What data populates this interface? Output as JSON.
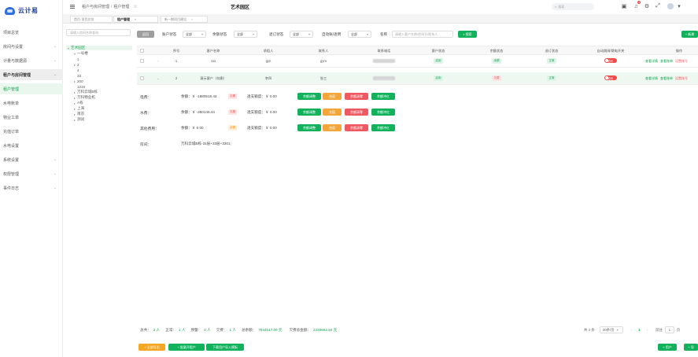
{
  "app": {
    "logo_text": "云计易"
  },
  "sidebar": {
    "items": [
      {
        "label": "项目总览",
        "chevron": false,
        "state": ""
      },
      {
        "label": "房间与设置",
        "chevron": true,
        "state": ""
      },
      {
        "label": "计量与数据源",
        "chevron": true,
        "state": ""
      },
      {
        "label": "租户与房间管理",
        "chevron": true,
        "state": "group-open"
      },
      {
        "label": "租户管理",
        "chevron": false,
        "state": "active"
      },
      {
        "label": "水电账单",
        "chevron": false,
        "state": ""
      },
      {
        "label": "物业工单",
        "chevron": false,
        "state": ""
      },
      {
        "label": "充值订单",
        "chevron": false,
        "state": ""
      },
      {
        "label": "水电设置",
        "chevron": false,
        "state": ""
      },
      {
        "label": "系统设置",
        "chevron": true,
        "state": ""
      },
      {
        "label": "权限管理",
        "chevron": true,
        "state": ""
      },
      {
        "label": "事件日志",
        "chevron": true,
        "state": ""
      }
    ]
  },
  "header": {
    "breadcrumb": [
      "租户与房间管理",
      "租户管理"
    ],
    "title": "艺术园区",
    "search_placeholder": "搜索",
    "notification_count": "8"
  },
  "tabs": [
    {
      "label": "首页·项目总览",
      "active": false,
      "closable": false
    },
    {
      "label": "租户管理",
      "active": true,
      "closable": true
    },
    {
      "label": "新一期项目建设",
      "active": false,
      "closable": true
    }
  ],
  "tree": {
    "search_placeholder": "请输入房间名称查询",
    "nodes": [
      {
        "label": "艺术园区",
        "level": 0,
        "arrow": "▾",
        "selected": true
      },
      {
        "label": "一号楼",
        "level": 1,
        "arrow": "▾",
        "selected": false
      },
      {
        "label": "1",
        "level": 1,
        "arrow": "",
        "selected": false
      },
      {
        "label": "2",
        "level": 1,
        "arrow": "▸",
        "selected": false
      },
      {
        "label": "4",
        "level": 1,
        "arrow": "",
        "selected": false
      },
      {
        "label": "33",
        "level": 1,
        "arrow": "",
        "selected": false
      },
      {
        "label": "200",
        "level": 1,
        "arrow": "▸",
        "selected": false
      },
      {
        "label": "1234",
        "level": 1,
        "arrow": "",
        "selected": false
      },
      {
        "label": "万科云城B栋",
        "level": 1,
        "arrow": "▸",
        "selected": false
      },
      {
        "label": "万科物业机",
        "level": 1,
        "arrow": "▸",
        "selected": false
      },
      {
        "label": "A栋",
        "level": 1,
        "arrow": "▸",
        "selected": false
      },
      {
        "label": "上海",
        "level": 1,
        "arrow": "▸",
        "selected": false
      },
      {
        "label": "南京",
        "level": 1,
        "arrow": "▸",
        "selected": false
      },
      {
        "label": "测试",
        "level": 1,
        "arrow": "▸",
        "selected": false
      }
    ]
  },
  "filters": {
    "back_label": "返回",
    "account_status_label": "账户状态",
    "account_status_value": "全部",
    "balance_status_label": "余额状态",
    "balance_status_value": "全部",
    "settle_status_label": "退订状态",
    "settle_status_value": "全部",
    "auto_label": "自动账/透明",
    "auto_value": "全部",
    "search_label": "名称",
    "search_placeholder": "请输入客户名称/房间号/联系人",
    "search_button": "搜索",
    "new_button": "+ 新建"
  },
  "table": {
    "columns": [
      "序号",
      "客户名称",
      "承租人",
      "联系人",
      "联系电话",
      "客户状态",
      "余额状态",
      "退订状态",
      "自动跳闸/跳电开关",
      "操作"
    ],
    "rows": [
      {
        "index": "1",
        "name": "111",
        "tenant": "gyn",
        "contact": "gym",
        "customer_status": "启用",
        "balance_status": "余额",
        "settle_status": "正常",
        "switch": "关闭",
        "ops": [
          "查看详情",
          "查看账单",
          "设置账号"
        ]
      },
      {
        "index": "2",
        "name": "演示客户（勿删）",
        "tenant": "李四",
        "contact": "张三",
        "customer_status": "启用",
        "balance_status": "欠费",
        "settle_status": "正常",
        "switch": "关闭",
        "ops": [
          "查看详情",
          "查看账单",
          "设置账号"
        ]
      }
    ]
  },
  "detail": {
    "electric": {
      "label": "电费：",
      "balance": "余额：￥ -1880518.43",
      "tag": "欠费",
      "warn": "透支额度：￥ 0.00",
      "buttons": [
        "余额调整",
        "充值",
        "余额清零",
        "余额冲红"
      ]
    },
    "water": {
      "label": "水费：",
      "balance": "余额：￥ -350146.44",
      "tag": "欠费",
      "warn": "透支额度：￥ 0.00",
      "buttons": [
        "余额调整",
        "充值",
        "余额清零",
        "余额冲红"
      ]
    },
    "property": {
      "label": "其他费用：",
      "balance": "余额：￥ 0.00",
      "tag": "余额",
      "warn": "透支额度：￥ 0.00",
      "buttons": [
        "余额调整",
        "充值",
        "余额清零",
        "余额冲红"
      ]
    },
    "room_label": "房间：",
    "room_value": "万科云城B栋-31层+33层+3301;"
  },
  "summary": {
    "total_label": "总共：",
    "total": "2 人",
    "normal_label": "正常：",
    "normal": "1 人",
    "warn_label": "预警：",
    "warn": "0 人",
    "overdue_label": "欠费：",
    "overdue": "1 人",
    "balance_label": "总余额：",
    "balance": "7844517.00 元",
    "owe_label": "欠费总金额：",
    "owe": "2230663.84 元"
  },
  "pager": {
    "total": "共 2 条",
    "per_page": "20条/页",
    "current": "1",
    "goto_label": "前往",
    "goto_value": "1",
    "page_suffix": "页"
  },
  "footer_buttons": {
    "export": "+ 全部导出",
    "batch": "+ 批量开租户",
    "import": "下载用户导入模板",
    "add": "+ 用户",
    "more": "+ 导"
  },
  "colors": {
    "accent": "#12b25c",
    "danger": "#ef5a62",
    "warn": "#f5a623"
  }
}
